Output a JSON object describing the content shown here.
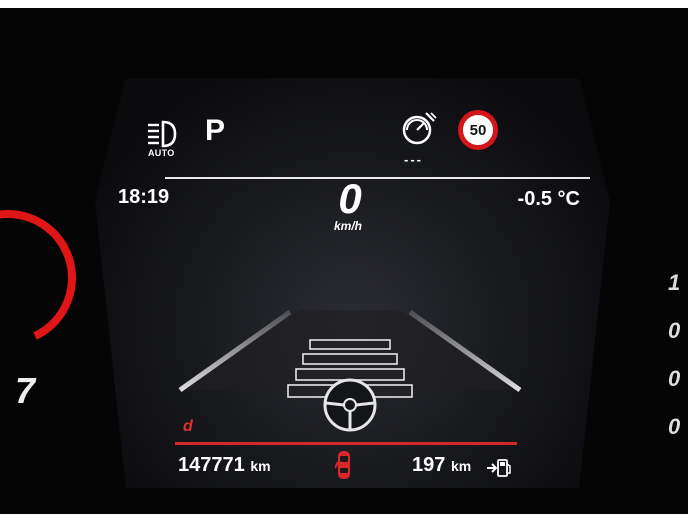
{
  "status": {
    "headlight_mode": "AUTO",
    "gear": "P",
    "speed_limit": "50",
    "cruise_set": "---"
  },
  "info": {
    "time": "18:19",
    "outside_temp": "-0.5 °C",
    "speed": "0",
    "speed_unit": "km/h"
  },
  "trip": {
    "drive_mode": "d",
    "odometer_value": "147771",
    "odometer_unit": "km",
    "range_value": "197",
    "range_unit": "km"
  },
  "gauges": {
    "left_tick": "7"
  },
  "colors": {
    "accent_red": "#d22a2a",
    "text": "#ffffff",
    "screen_bg": "#18191d"
  },
  "icons": [
    "headlight-auto-icon",
    "speed-assist-icon",
    "speed-limit-sign-icon",
    "car-door-open-icon",
    "fuel-station-icon",
    "steering-wheel-icon"
  ]
}
